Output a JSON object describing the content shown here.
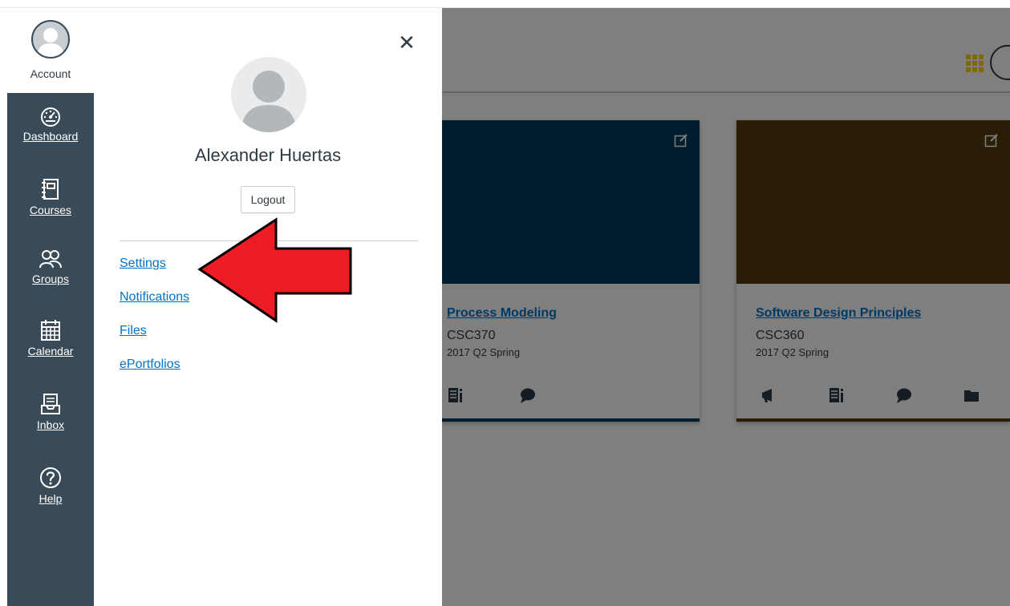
{
  "global_nav": {
    "account_label": "Account",
    "items": [
      {
        "label": "Dashboard",
        "icon": "dashboard-icon"
      },
      {
        "label": "Courses",
        "icon": "courses-icon"
      },
      {
        "label": "Groups",
        "icon": "groups-icon"
      },
      {
        "label": "Calendar",
        "icon": "calendar-icon"
      },
      {
        "label": "Inbox",
        "icon": "inbox-icon"
      },
      {
        "label": "Help",
        "icon": "help-icon"
      }
    ]
  },
  "tray": {
    "close_glyph": "✕",
    "user_name": "Alexander Huertas",
    "logout_label": "Logout",
    "links": [
      "Settings",
      "Notifications",
      "Files",
      "ePortfolios"
    ]
  },
  "dashboard": {
    "cards": [
      {
        "title": "Process Modeling",
        "code": "CSC370",
        "term": "2017 Q2 Spring",
        "color": "#003a5c",
        "actions": [
          "assignments-icon",
          "discussions-icon"
        ]
      },
      {
        "title": "Software Design Principles",
        "code": "CSC360",
        "term": "2017 Q2 Spring",
        "color": "#523b0a",
        "actions": [
          "announcements-icon",
          "assignments-icon",
          "discussions-icon",
          "files-icon"
        ]
      }
    ]
  },
  "colors": {
    "nav_bg": "#394b58",
    "link": "#0073c7",
    "overlay": "rgba(0,0,0,0.5)",
    "annotation_arrow": "#ed1c24"
  }
}
